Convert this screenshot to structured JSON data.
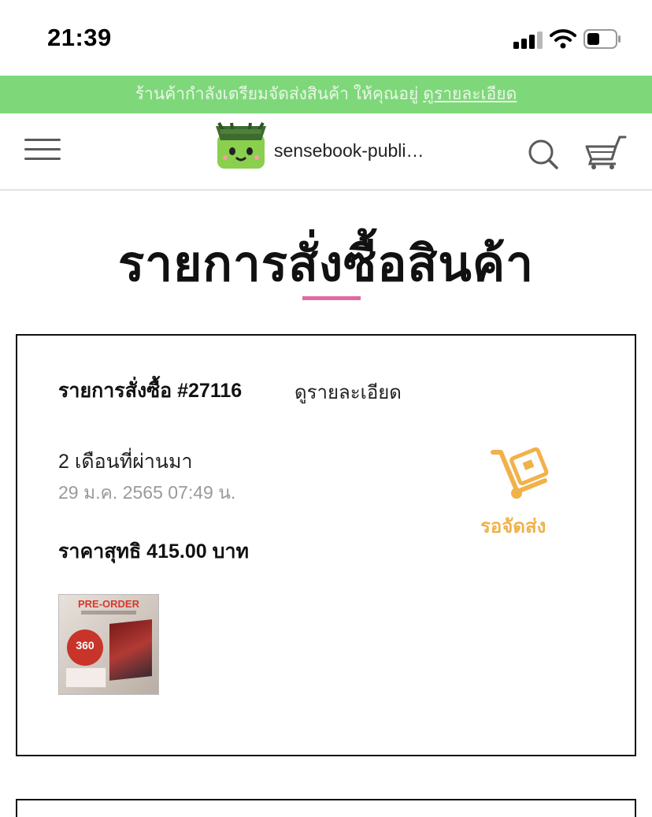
{
  "status_bar": {
    "time": "21:39"
  },
  "banner": {
    "text": "ร้านค้ากำลังเตรียมจัดส่งสินค้า ให้คุณอยู่",
    "link_label": "ดูรายละเอียด",
    "background_color": "#7ed87a"
  },
  "header": {
    "menu_icon": "hamburger-menu-icon",
    "shop_name": "sensebook-publi…",
    "search_icon": "search-icon",
    "cart_icon": "cart-icon"
  },
  "page": {
    "title": "รายการสั่งซื้อสินค้า",
    "accent_color": "#e06aa1"
  },
  "orders": [
    {
      "label": "รายการสั่งซื้อ #27116",
      "detail_link": "ดูรายละเอียด",
      "relative_time": "2 เดือนที่ผ่านมา",
      "date": "29 ม.ค. 2565 07:49 น.",
      "total": "ราคาสุทธิ 415.00 บาท",
      "status": "รอจัดส่ง",
      "status_color": "#f0b24a",
      "status_icon": "hand-truck-box-icon",
      "product_thumbnail": {
        "badge": "PRE-ORDER",
        "price": "360"
      }
    }
  ]
}
